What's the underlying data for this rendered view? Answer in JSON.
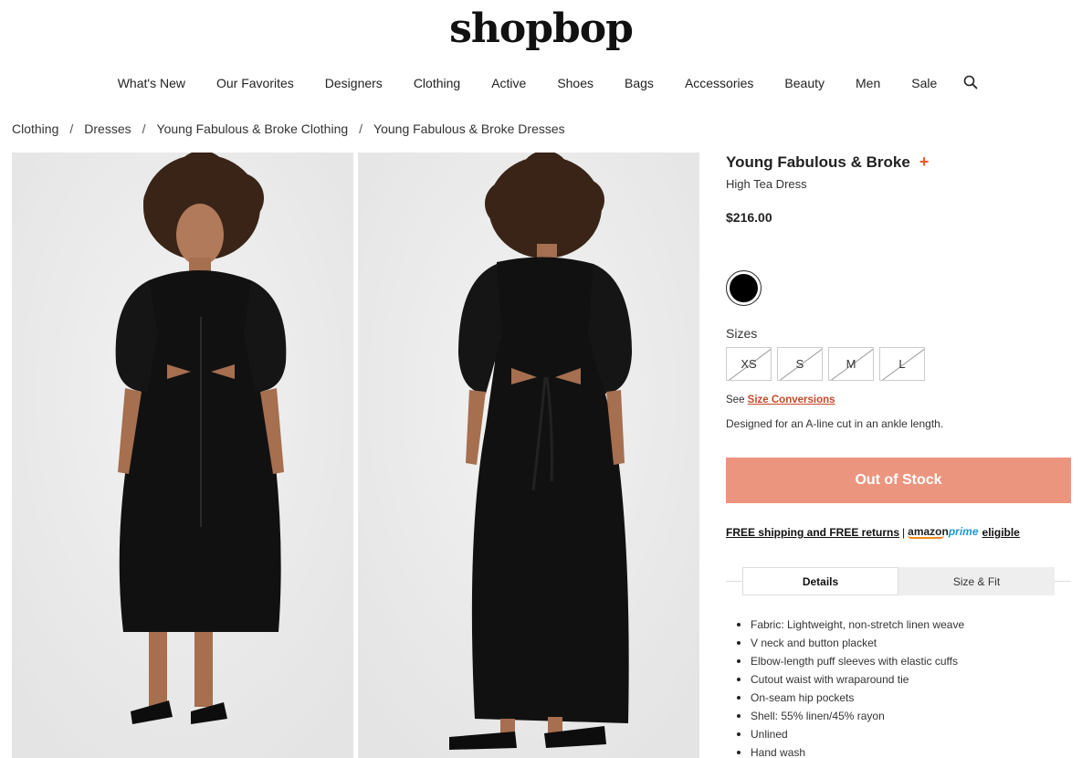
{
  "logo": "shopbop",
  "nav": {
    "items": [
      "What's New",
      "Our Favorites",
      "Designers",
      "Clothing",
      "Active",
      "Shoes",
      "Bags",
      "Accessories",
      "Beauty",
      "Men",
      "Sale"
    ]
  },
  "breadcrumb": [
    "Clothing",
    "Dresses",
    "Young Fabulous & Broke Clothing",
    "Young Fabulous & Broke Dresses"
  ],
  "breadcrumb_separator": "/",
  "product": {
    "brand": "Young Fabulous & Broke",
    "brand_plus": "+",
    "name": "High Tea Dress",
    "price": "$216.00",
    "color_swatch": "#000000",
    "sizes_label": "Sizes",
    "sizes": [
      "XS",
      "S",
      "M",
      "L"
    ],
    "see_label": "See",
    "size_conversions": "Size Conversions",
    "description": "Designed for an A-line cut in an ankle length.",
    "button_label": "Out of Stock"
  },
  "shipping": {
    "text": "FREE shipping and FREE returns",
    "separator": "|",
    "amazon": "amazon",
    "prime": "prime",
    "eligible": "eligible"
  },
  "tabs": {
    "details": "Details",
    "size_fit": "Size & Fit"
  },
  "details_list": [
    "Fabric: Lightweight, non-stretch linen weave",
    "V neck and button placket",
    "Elbow-length puff sleeves with elastic cuffs",
    "Cutout waist with wraparound tie",
    "On-seam hip pockets",
    "Shell: 55% linen/45% rayon",
    "Unlined",
    "Hand wash"
  ],
  "colors": {
    "accent": "#e8572d",
    "oos_button": "#ec957e",
    "link": "#c8482a",
    "prime_blue": "#1a98d5"
  }
}
